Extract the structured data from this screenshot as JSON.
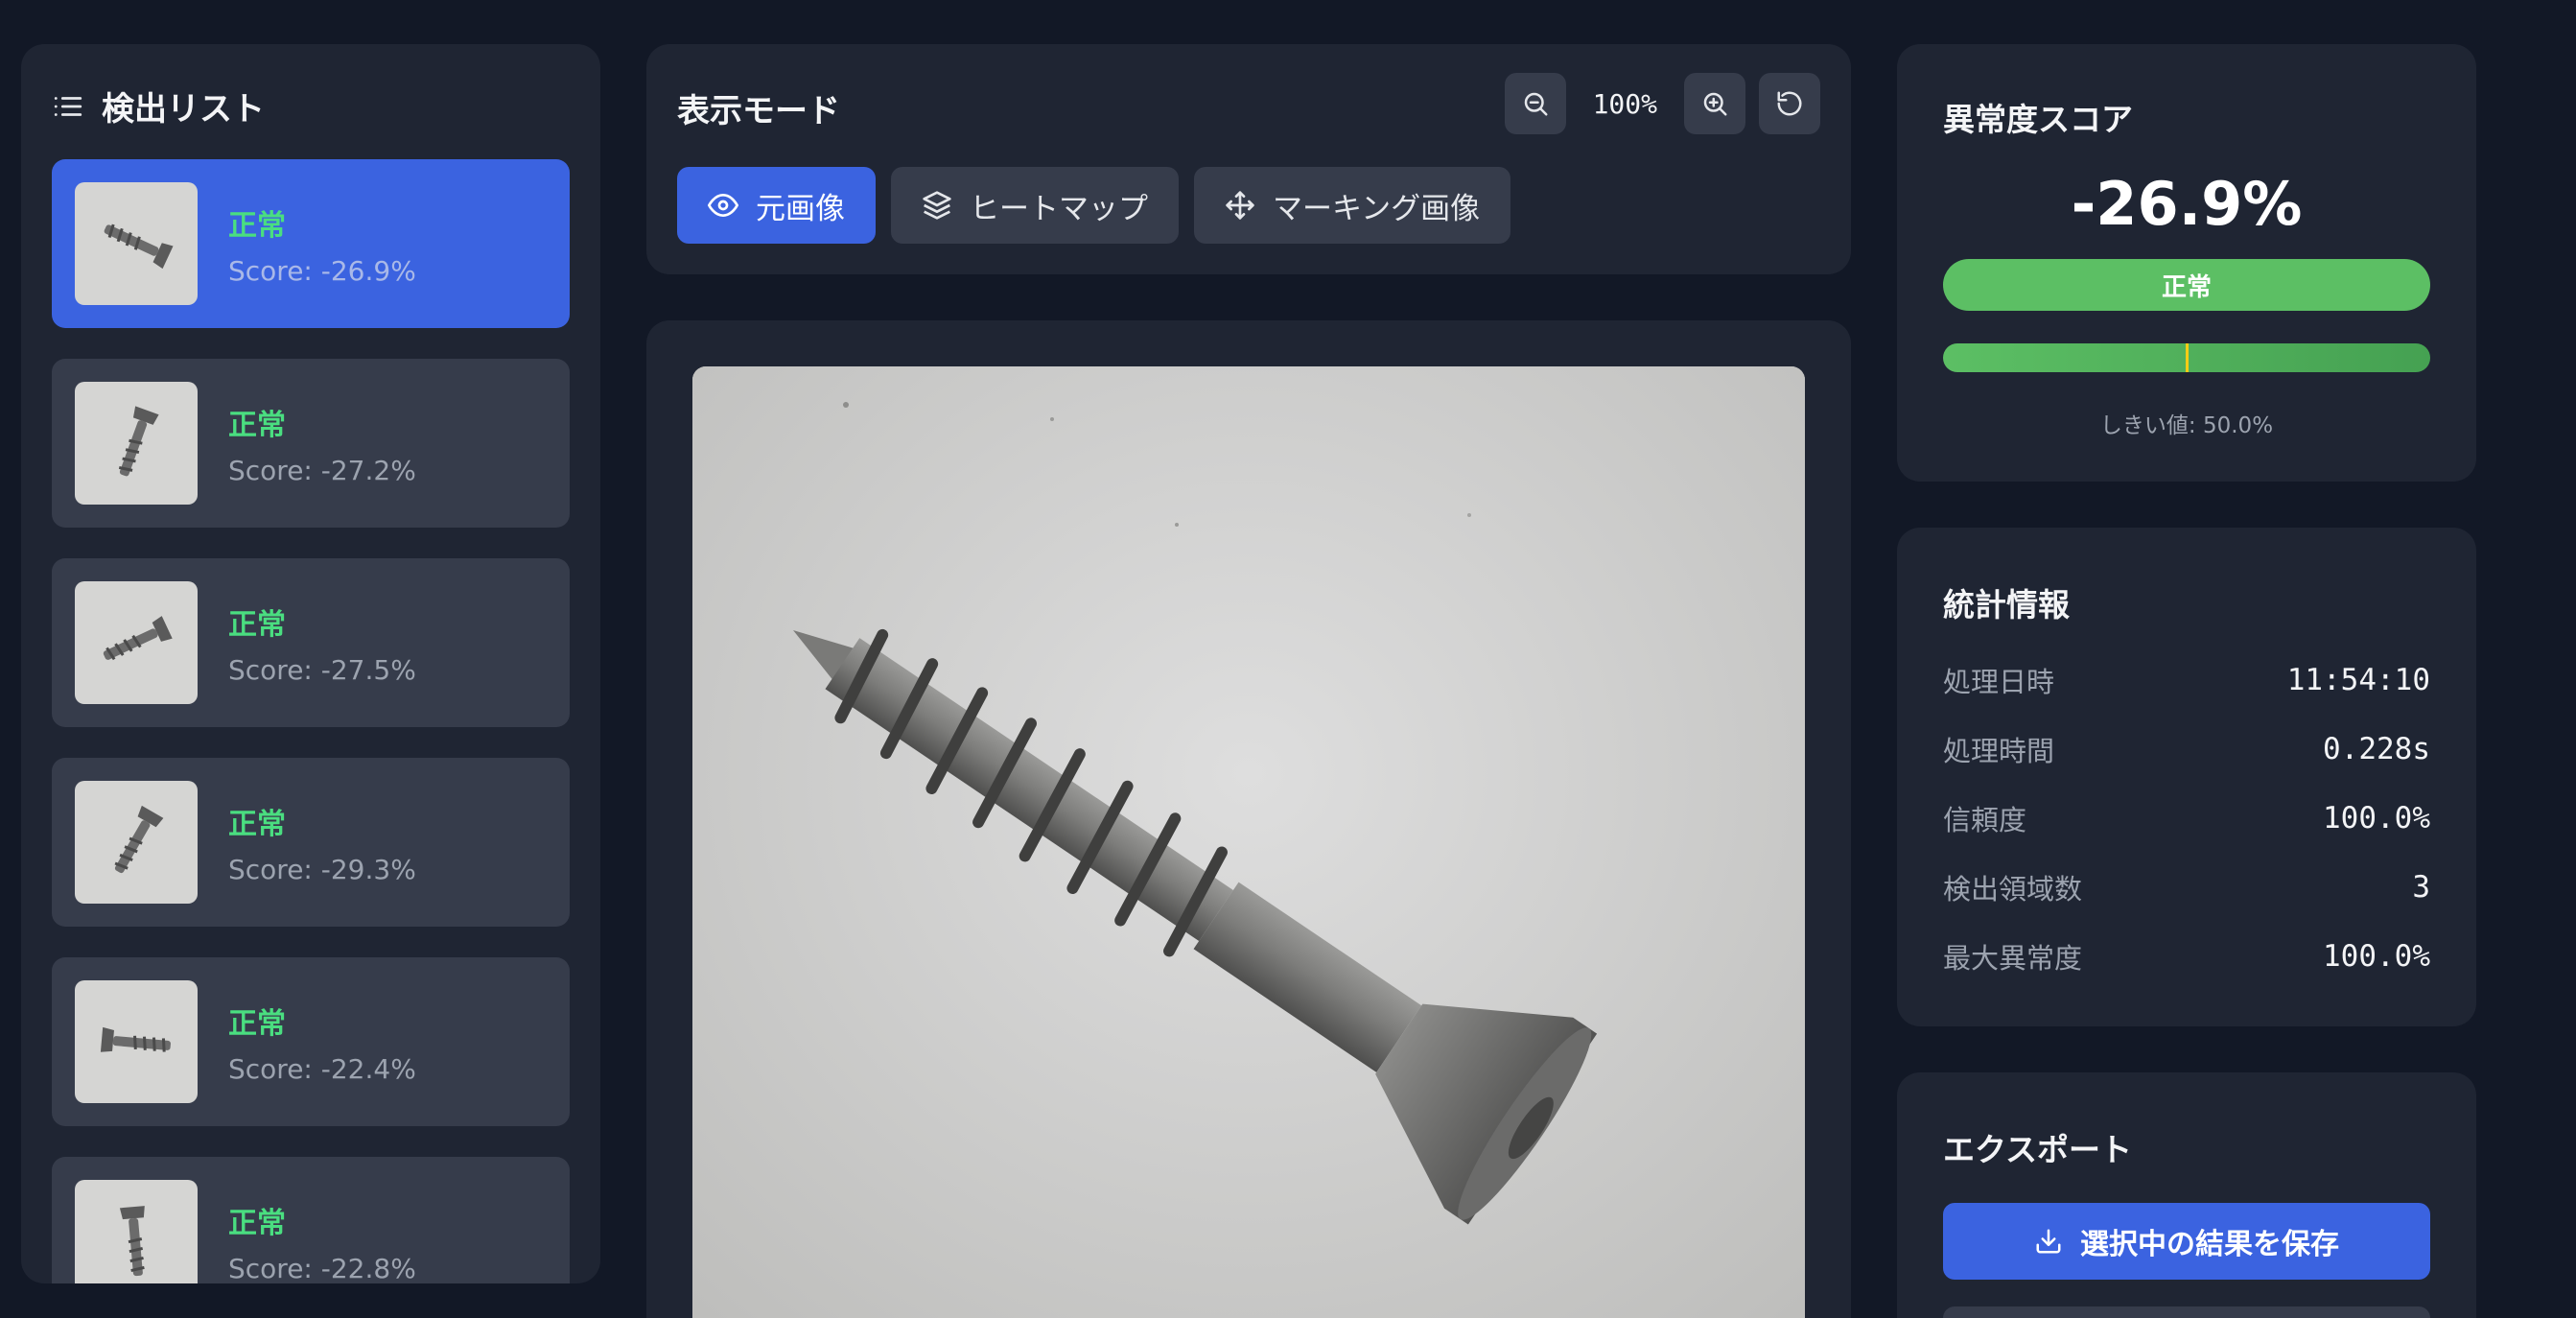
{
  "detection_list": {
    "title": "検出リスト",
    "items": [
      {
        "status": "正常",
        "score": "Score: -26.9%",
        "active": true
      },
      {
        "status": "正常",
        "score": "Score: -27.2%",
        "active": false
      },
      {
        "status": "正常",
        "score": "Score: -27.5%",
        "active": false
      },
      {
        "status": "正常",
        "score": "Score: -29.3%",
        "active": false
      },
      {
        "status": "正常",
        "score": "Score: -22.4%",
        "active": false
      },
      {
        "status": "正常",
        "score": "Score: -22.8%",
        "active": false
      }
    ]
  },
  "display_mode": {
    "title": "表示モード",
    "zoom": "100%",
    "buttons": [
      {
        "label": "元画像",
        "icon": "eye-icon",
        "active": true
      },
      {
        "label": "ヒートマップ",
        "icon": "layers-icon",
        "active": false
      },
      {
        "label": "マーキング画像",
        "icon": "move-icon",
        "active": false
      }
    ]
  },
  "anomaly_score": {
    "title": "異常度スコア",
    "value": "-26.9%",
    "badge": "正常",
    "threshold_text": "しきい値: 50.0%",
    "threshold_fraction": 0.5,
    "colors": {
      "normal": "#5cbf64",
      "marker": "#facc15"
    }
  },
  "stats": {
    "title": "統計情報",
    "rows": [
      {
        "label": "処理日時",
        "value": "11:54:10"
      },
      {
        "label": "処理時間",
        "value": "0.228s"
      },
      {
        "label": "信頼度",
        "value": "100.0%"
      },
      {
        "label": "検出領域数",
        "value": "3"
      },
      {
        "label": "最大異常度",
        "value": "100.0%"
      }
    ]
  },
  "export": {
    "title": "エクスポート",
    "save_label": "選択中の結果を保存"
  },
  "theme": {
    "accent": "#3b63e0",
    "success_text": "#4ade80",
    "background": "#121826"
  }
}
